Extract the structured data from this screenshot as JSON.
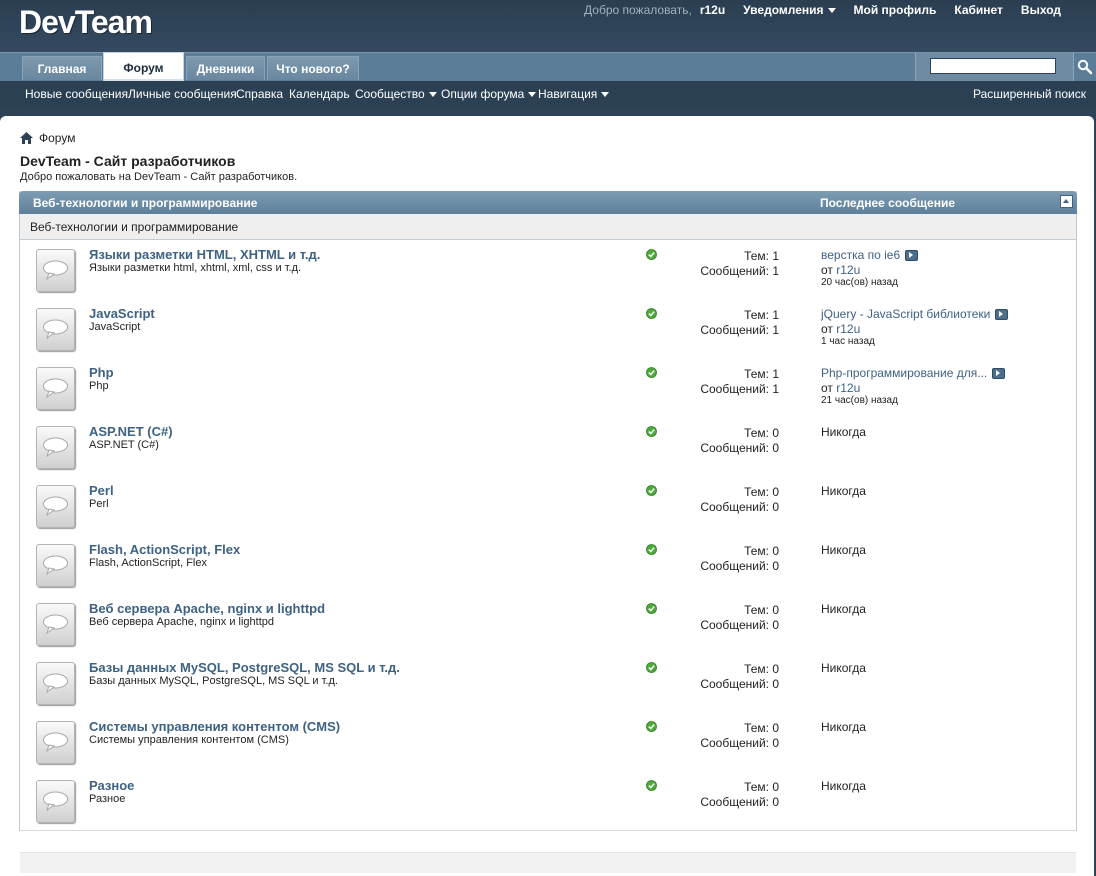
{
  "header": {
    "logo": "DevTeam",
    "welcome": "Добро пожаловать,",
    "username": "r12u",
    "links": [
      "Уведомления",
      "Мой профиль",
      "Кабинет",
      "Выход"
    ]
  },
  "tabs": [
    "Главная",
    "Форум",
    "Дневники",
    "Что нового?"
  ],
  "active_tab": "Форум",
  "search": {
    "value": "",
    "icon": "search-icon"
  },
  "subnav": {
    "items": [
      "Новые сообщения",
      "Личные сообщения",
      "Справка",
      "Календарь",
      "Сообщество",
      "Опции форума",
      "Навигация"
    ],
    "advanced_search": "Расширенный поиск"
  },
  "breadcrumb": {
    "icon": "home-icon",
    "label": "Форум"
  },
  "page": {
    "title": "DevTeam - Сайт разработчиков",
    "description": "Добро пожаловать на DevTeam - Сайт разработчиков."
  },
  "category": {
    "title": "Веб-технологии и программирование",
    "last_post_header": "Последнее сообщение",
    "description": "Веб-технологии и программирование"
  },
  "labels": {
    "threads": "Тем:",
    "posts": "Сообщений:",
    "by": "от"
  },
  "forums": [
    {
      "name": "Языки разметки HTML, XHTML и т.д.",
      "desc": "Языки разметки html, xhtml, xml, css и т.д.",
      "threads": "1",
      "posts": "1",
      "last_title": "верстка по ie6",
      "last_user": "r12u",
      "last_time": "20 час(ов) назад"
    },
    {
      "name": "JavaScript",
      "desc": "JavaScript",
      "threads": "1",
      "posts": "1",
      "last_title": "jQuery - JavaScript библиотеки",
      "last_user": "r12u",
      "last_time": "1 час назад"
    },
    {
      "name": "Php",
      "desc": "Php",
      "threads": "1",
      "posts": "1",
      "last_title": "Php-программирование для...",
      "last_user": "r12u",
      "last_time": "21 час(ов) назад"
    },
    {
      "name": "ASP.NET (C#)",
      "desc": "ASP.NET (C#)",
      "threads": "0",
      "posts": "0",
      "last_never": "Никогда"
    },
    {
      "name": "Perl",
      "desc": "Perl",
      "threads": "0",
      "posts": "0",
      "last_never": "Никогда"
    },
    {
      "name": "Flash, ActionScript, Flex",
      "desc": "Flash, ActionScript, Flex",
      "threads": "0",
      "posts": "0",
      "last_never": "Никогда"
    },
    {
      "name": "Веб сервера Apache, nginx и lighttpd",
      "desc": "Веб сервера Apache, nginx и lighttpd",
      "threads": "0",
      "posts": "0",
      "last_never": "Никогда"
    },
    {
      "name": "Базы данных MySQL, PostgreSQL, MS SQL и т.д.",
      "desc": "Базы данных MySQL, PostgreSQL, MS SQL и т.д.",
      "threads": "0",
      "posts": "0",
      "last_never": "Никогда"
    },
    {
      "name": "Системы управления контентом (CMS)",
      "desc": "Системы управления контентом (CMS)",
      "threads": "0",
      "posts": "0",
      "last_never": "Никогда"
    },
    {
      "name": "Разное",
      "desc": "Разное",
      "threads": "0",
      "posts": "0",
      "last_never": "Никогда"
    }
  ]
}
